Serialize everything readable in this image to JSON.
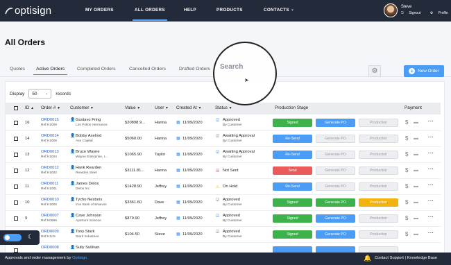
{
  "nav": {
    "logo": "optisign",
    "links": [
      "MY ORDERS",
      "ALL ORDERS",
      "HELP",
      "PRODUCTS",
      "CONTACTS"
    ],
    "active": "ALL ORDERS",
    "user_name": "Steve",
    "signout": "Signout",
    "profile": "Profile"
  },
  "page": {
    "title": "All Orders",
    "tabs": [
      "Quotes",
      "Active Orders",
      "Completed Orders",
      "Cancelled Orders",
      "Drafted Orders"
    ],
    "active_tab": "Active Orders",
    "search_placeholder": "Search",
    "new_order": "New Order"
  },
  "table": {
    "display_label": "Display",
    "display_value": "50",
    "records_label": "records",
    "headers": [
      "ID",
      "Order #",
      "Customer",
      "Value",
      "User",
      "Created At",
      "Status",
      "Production Stage",
      "Payment"
    ],
    "rows": [
      {
        "id": "16",
        "order": "ORD0015",
        "ref": "Ref:H1009",
        "customer": "Gustavo Fring",
        "company": "Los Pollos Hermanos",
        "value": "$20898.9...",
        "user": "Hanna",
        "date": "11/09/2020",
        "status": "Approved",
        "status_sub": "By Customer",
        "status_type": "approved",
        "b1": "Signed",
        "b1t": "green",
        "b2": "Generate PO",
        "b2t": "blue",
        "b3": "Production",
        "b3t": "grey"
      },
      {
        "id": "14",
        "order": "ORD0014",
        "ref": "Ref:H1008",
        "customer": "Bobby Axelrod",
        "company": "Axe Capital",
        "value": "$5060.00",
        "user": "Hanna",
        "date": "11/09/2020",
        "status": "Awaiting Approval",
        "status_sub": "By Customer",
        "status_type": "awaiting",
        "b1": "Re-Send",
        "b1t": "blue",
        "b2": "Generate PO",
        "b2t": "grey",
        "b3": "Production",
        "b3t": "grey"
      },
      {
        "id": "13",
        "order": "ORD0013",
        "ref": "Ref:H1004",
        "customer": "Bruce Wayne",
        "company": "Wayne Enterprise, I...",
        "value": "$1065.90",
        "user": "Taylor",
        "date": "11/09/2020",
        "status": "Awaiting Approval",
        "status_sub": "By Customer",
        "status_type": "awaiting",
        "b1": "Re-Send",
        "b1t": "blue",
        "b2": "Generate PO",
        "b2t": "grey",
        "b3": "Production",
        "b3t": "grey"
      },
      {
        "id": "12",
        "order": "ORD0012",
        "ref": "Ref:H1003",
        "customer": "Hank Rearden",
        "company": "Rearden Steel",
        "value": "$3111.81...",
        "user": "Hanna",
        "date": "11/09/2020",
        "status": "Not Sent",
        "status_sub": "",
        "status_type": "notsent",
        "b1": "Send",
        "b1t": "red",
        "b2": "Generate PO",
        "b2t": "grey",
        "b3": "Production",
        "b3t": "grey"
      },
      {
        "id": "11",
        "order": "ORD0011",
        "ref": "Ref:H1001",
        "customer": "James Delos",
        "company": "Delos Inc",
        "value": "$1428.90",
        "user": "Jeffrey",
        "date": "11/09/2020",
        "status": "On Hold",
        "status_sub": "",
        "status_type": "onhold",
        "b1": "Re-Send",
        "b1t": "blue",
        "b2": "Generate PO",
        "b2t": "grey",
        "b3": "Production",
        "b3t": "grey"
      },
      {
        "id": "10",
        "order": "ORD0010",
        "ref": "Ref:H1000",
        "customer": "Tycho Nestoris",
        "company": "Iron Bank of Braavos",
        "value": "$3361.60",
        "user": "Dave",
        "date": "11/09/2020",
        "status": "Approved",
        "status_sub": "By Customer",
        "status_type": "approved",
        "b1": "Signed",
        "b1t": "green",
        "b2": "Generate PO",
        "b2t": "green",
        "b3": "Production",
        "b3t": "orange"
      },
      {
        "id": "9",
        "order": "ORD0007",
        "ref": "Ref:H0999",
        "customer": "Cave Johnson",
        "company": "Aperture Science",
        "value": "$879.90",
        "user": "Jeffrey",
        "date": "11/09/2020",
        "status": "Approved",
        "status_sub": "By Customer",
        "status_type": "approved",
        "b1": "Signed",
        "b1t": "green",
        "b2": "Generate PO",
        "b2t": "blue",
        "b3": "Production",
        "b3t": "grey"
      },
      {
        "id": "8",
        "order": "ORD0009",
        "ref": "Ref:H1ctv",
        "customer": "Tony Stark",
        "company": "Stark Industries",
        "value": "$104.50",
        "user": "Steve",
        "date": "11/09/2020",
        "status": "Approved",
        "status_sub": "By Customer",
        "status_type": "approved",
        "b1": "Signed",
        "b1t": "green",
        "b2": "Generate PO",
        "b2t": "blue",
        "b3": "Production",
        "b3t": "grey"
      },
      {
        "id": "",
        "order": "ORD0008",
        "ref": "",
        "customer": "Sully Sullivan",
        "company": "",
        "value": "",
        "user": "",
        "date": "",
        "status": "",
        "status_sub": "",
        "status_type": "",
        "b1": "",
        "b1t": "blue",
        "b2": "",
        "b2t": "blue",
        "b3": "",
        "b3t": "grey"
      }
    ]
  },
  "footer": {
    "left": "Approvals and order management by",
    "brand": "Optisign",
    "right": "Contact Support | Knowledge Base"
  },
  "colors": {
    "nav_bg": "#232a3a",
    "accent": "#4a9cf5",
    "green": "#3db24a",
    "red": "#ec5b5b",
    "orange": "#f2b20f"
  }
}
